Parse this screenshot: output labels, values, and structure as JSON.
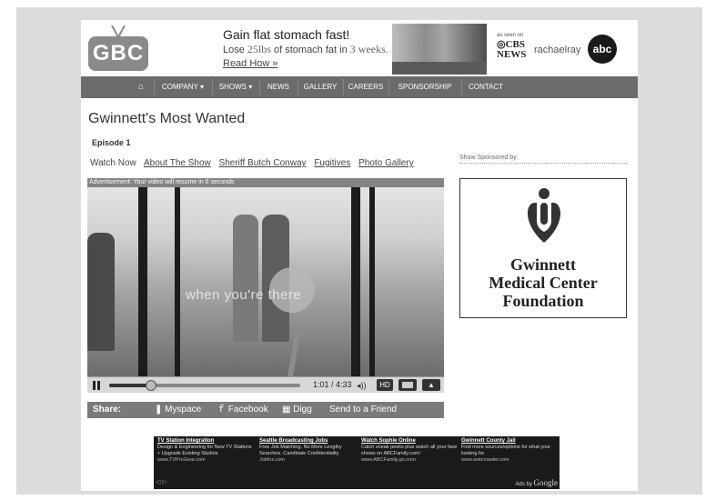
{
  "header": {
    "logo": "GBC",
    "ad_headline": "Gain flat stomach fast!",
    "ad_sub_prefix": "Lose",
    "ad_sub_num1": "25lbs",
    "ad_sub_mid": "of stomach fat in",
    "ad_sub_num2": "3 weeks.",
    "ad_link": "Read How »",
    "seen_on": "as seen on",
    "cbs_line1": "◎CBS",
    "cbs_line2": "NEWS",
    "rachael": "rachaelray",
    "abc": "abc"
  },
  "nav": {
    "items": [
      {
        "label": "⌂"
      },
      {
        "label": "COMPANY ▾"
      },
      {
        "label": "SHOWS ▾"
      },
      {
        "label": "NEWS"
      },
      {
        "label": "GALLERY"
      },
      {
        "label": "CAREERS"
      },
      {
        "label": "SPONSORSHIP"
      },
      {
        "label": "CONTACT"
      }
    ]
  },
  "main": {
    "title": "Gwinnett's Most Wanted",
    "episode": "Episode 1",
    "tabs": {
      "watch": "Watch Now",
      "about": "About The Show",
      "sheriff": "Sheriff Butch Conway",
      "fugitives": "Fugitives",
      "photos": "Photo Gallery"
    }
  },
  "video": {
    "ad_notice": "Advertisement: Your video will resume in 6 seconds",
    "caption": "when you're  there",
    "time": "1:01 / 4:33",
    "progress": 0.22,
    "hd_label": "HD",
    "up_label": "▲"
  },
  "share": {
    "label": "Share:",
    "myspace": "Myspace",
    "facebook": "Facebook",
    "digg": "Digg",
    "send": "Send to a Friend"
  },
  "sponsor": {
    "label": "Show Sponsored by:",
    "name_line1": "Gwinnett",
    "name_line2": "Medical Center",
    "name_line3": "Foundation"
  },
  "ads": {
    "items": [
      {
        "title": "TV Station Integration",
        "desc": "Design & Engineering for New TV Stations + Upgrade Existing Studios",
        "url": "www.TVProGear.com"
      },
      {
        "title": "Seattle Broadcasting Jobs",
        "desc": "Free Job Matching. No More Lengthy Searches. Candidate Confidentiality",
        "url": "Jobfox.com"
      },
      {
        "title": "Watch Sophie Online",
        "desc": "Catch sneak peeks plus watch all your fave shows on ABCFamily.com!",
        "url": "www.ABCFamily.go.com"
      },
      {
        "title": "Gwinnett County Jail",
        "desc": "Find more sources/options for what your looking for",
        "url": "www.webcrawler.com"
      }
    ],
    "nav": "◁ ▷",
    "ads_by": "Ads by",
    "google": "Google"
  }
}
